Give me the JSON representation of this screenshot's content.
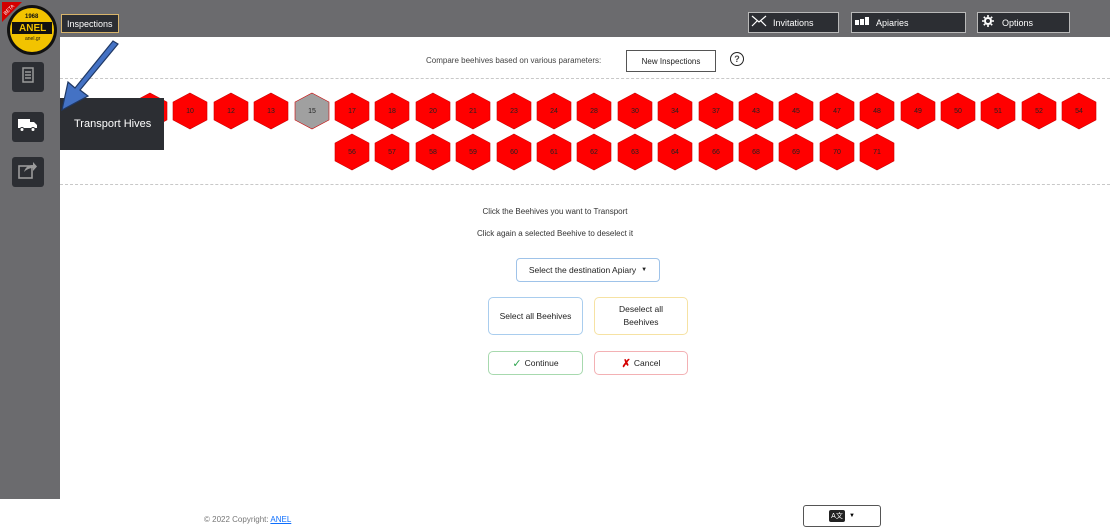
{
  "topbar": {
    "inspections_label": "Inspections",
    "invitations_label": "Invitations",
    "apiaries_label": "Apiaries",
    "options_label": "Options"
  },
  "logo": {
    "year": "1968",
    "brand": "ANEL",
    "site": "anel.gr",
    "ribbon": "BETA"
  },
  "sidebar": {
    "tooltip": "Transport Hives",
    "items": [
      {
        "icon": "inspections-icon"
      },
      {
        "icon": "truck-icon"
      },
      {
        "icon": "share-icon"
      }
    ]
  },
  "compare": {
    "text": "Compare beehives based on various parameters:",
    "new_inspections_label": "New Inspections"
  },
  "hives_row1": [
    "",
    "10",
    "12",
    "13",
    "15",
    "17",
    "18",
    "20",
    "21",
    "23",
    "24",
    "28",
    "30",
    "34",
    "37",
    "43",
    "45",
    "47",
    "48",
    "49",
    "50",
    "51",
    "52",
    "54"
  ],
  "hives_row2": [
    "56",
    "57",
    "58",
    "59",
    "60",
    "61",
    "62",
    "63",
    "64",
    "66",
    "68",
    "69",
    "70",
    "71"
  ],
  "hive_colors": {
    "unselected": "#ff0000",
    "disabled": "#a0a0a0"
  },
  "instructions": {
    "line1": "Click the Beehives you want to Transport",
    "line2": "Click again a selected Beehive to deselect it"
  },
  "apiary_select": {
    "label": "Select the destination Apiary"
  },
  "buttons": {
    "select_all": "Select all Beehives",
    "deselect_all_line1": "Deselect all",
    "deselect_all_line2": "Beehives",
    "continue": "Continue",
    "cancel": "Cancel"
  },
  "footer": {
    "copyright_prefix": "© 2022 Copyright:",
    "copyright_link": "ANEL"
  }
}
